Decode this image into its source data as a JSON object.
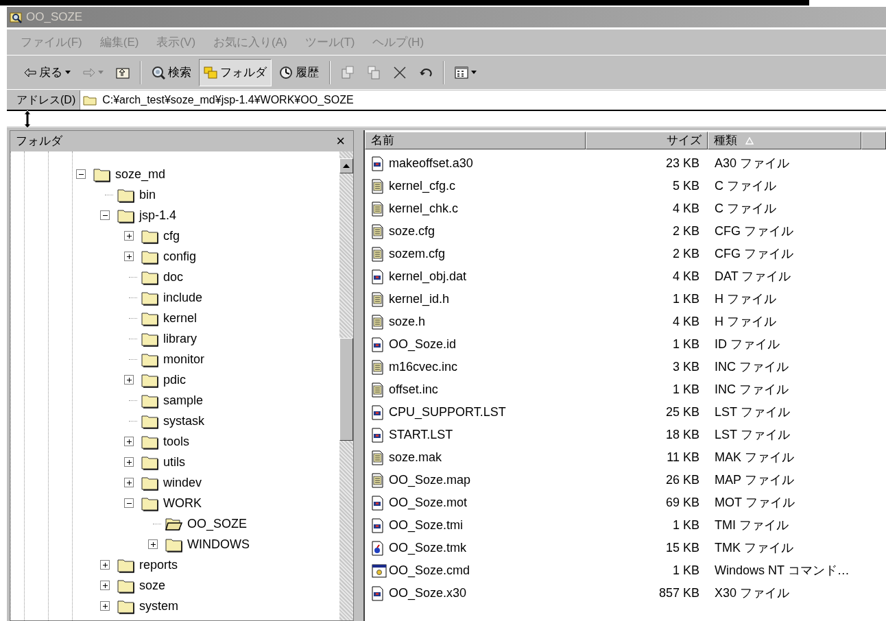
{
  "window": {
    "title": "OO_SOZE"
  },
  "menu": [
    {
      "label": "ファイル(F)"
    },
    {
      "label": "編集(E)"
    },
    {
      "label": "表示(V)"
    },
    {
      "label": "お気に入り(A)"
    },
    {
      "label": "ツール(T)"
    },
    {
      "label": "ヘルプ(H)"
    }
  ],
  "toolbar": [
    {
      "kind": "back",
      "label": "戻る",
      "pressed": false
    },
    {
      "kind": "forward",
      "pressed": false,
      "disabled": true
    },
    {
      "kind": "up",
      "pressed": false
    },
    {
      "kind": "separator"
    },
    {
      "kind": "search",
      "label": "検索",
      "pressed": false
    },
    {
      "kind": "folders",
      "label": "フォルダ",
      "pressed": true
    },
    {
      "kind": "history",
      "label": "履歴",
      "pressed": false
    },
    {
      "kind": "separator"
    },
    {
      "kind": "move",
      "pressed": false
    },
    {
      "kind": "copy",
      "pressed": false
    },
    {
      "kind": "delete",
      "pressed": false
    },
    {
      "kind": "undo",
      "pressed": false
    },
    {
      "kind": "separator"
    },
    {
      "kind": "views",
      "pressed": false
    }
  ],
  "address": {
    "label": "アドレス(D)",
    "value": "C:¥arch_test¥soze_md¥jsp-1.4¥WORK¥OO_SOZE"
  },
  "folder_pane": {
    "title": "フォルダ",
    "close": "×",
    "tree": [
      {
        "name": "soze_md",
        "expanded": true,
        "current": false,
        "children": [
          {
            "name": "bin",
            "current": false
          },
          {
            "name": "jsp-1.4",
            "expanded": true,
            "current": false,
            "children": [
              {
                "name": "cfg",
                "expanded": false,
                "current": false
              },
              {
                "name": "config",
                "expanded": false,
                "current": false
              },
              {
                "name": "doc",
                "current": false
              },
              {
                "name": "include",
                "current": false
              },
              {
                "name": "kernel",
                "current": false
              },
              {
                "name": "library",
                "current": false
              },
              {
                "name": "monitor",
                "current": false
              },
              {
                "name": "pdic",
                "expanded": false,
                "current": false
              },
              {
                "name": "sample",
                "current": false
              },
              {
                "name": "systask",
                "current": false
              },
              {
                "name": "tools",
                "expanded": false,
                "current": false
              },
              {
                "name": "utils",
                "expanded": false,
                "current": false
              },
              {
                "name": "windev",
                "expanded": false,
                "current": false
              },
              {
                "name": "WORK",
                "expanded": true,
                "current": false,
                "children": [
                  {
                    "name": "OO_SOZE",
                    "current": true
                  },
                  {
                    "name": "WINDOWS",
                    "expanded": false,
                    "current": false
                  }
                ]
              }
            ]
          },
          {
            "name": "reports",
            "expanded": false,
            "current": false
          },
          {
            "name": "soze",
            "expanded": false,
            "current": false
          },
          {
            "name": "system",
            "expanded": false,
            "current": false
          }
        ]
      }
    ]
  },
  "file_list": {
    "columns": [
      {
        "label": "名前",
        "sorted": false
      },
      {
        "label": "サイズ",
        "sorted": false
      },
      {
        "label": "種類",
        "sorted": true
      }
    ],
    "rows": [
      {
        "name": "makeoffset.a30",
        "size": "23 KB",
        "type": "A30 ファイル",
        "kind": "generic"
      },
      {
        "name": "kernel_cfg.c",
        "size": "5 KB",
        "type": "C ファイル",
        "kind": "text"
      },
      {
        "name": "kernel_chk.c",
        "size": "4 KB",
        "type": "C ファイル",
        "kind": "text"
      },
      {
        "name": "soze.cfg",
        "size": "2 KB",
        "type": "CFG ファイル",
        "kind": "text"
      },
      {
        "name": "sozem.cfg",
        "size": "2 KB",
        "type": "CFG ファイル",
        "kind": "text"
      },
      {
        "name": "kernel_obj.dat",
        "size": "4 KB",
        "type": "DAT ファイル",
        "kind": "generic"
      },
      {
        "name": "kernel_id.h",
        "size": "1 KB",
        "type": "H ファイル",
        "kind": "text"
      },
      {
        "name": "soze.h",
        "size": "4 KB",
        "type": "H ファイル",
        "kind": "text"
      },
      {
        "name": "OO_Soze.id",
        "size": "1 KB",
        "type": "ID ファイル",
        "kind": "generic"
      },
      {
        "name": "m16cvec.inc",
        "size": "3 KB",
        "type": "INC ファイル",
        "kind": "text"
      },
      {
        "name": "offset.inc",
        "size": "1 KB",
        "type": "INC ファイル",
        "kind": "text"
      },
      {
        "name": "CPU_SUPPORT.LST",
        "size": "25 KB",
        "type": "LST ファイル",
        "kind": "generic"
      },
      {
        "name": "START.LST",
        "size": "18 KB",
        "type": "LST ファイル",
        "kind": "generic"
      },
      {
        "name": "soze.mak",
        "size": "11 KB",
        "type": "MAK ファイル",
        "kind": "text"
      },
      {
        "name": "OO_Soze.map",
        "size": "26 KB",
        "type": "MAP ファイル",
        "kind": "text"
      },
      {
        "name": "OO_Soze.mot",
        "size": "69 KB",
        "type": "MOT ファイル",
        "kind": "generic"
      },
      {
        "name": "OO_Soze.tmi",
        "size": "1 KB",
        "type": "TMI ファイル",
        "kind": "generic"
      },
      {
        "name": "OO_Soze.tmk",
        "size": "15 KB",
        "type": "TMK ファイル",
        "kind": "project"
      },
      {
        "name": "OO_Soze.cmd",
        "size": "1 KB",
        "type": "Windows NT コマンド…",
        "kind": "command"
      },
      {
        "name": "OO_Soze.x30",
        "size": "857 KB",
        "type": "X30 ファイル",
        "kind": "generic"
      }
    ]
  }
}
